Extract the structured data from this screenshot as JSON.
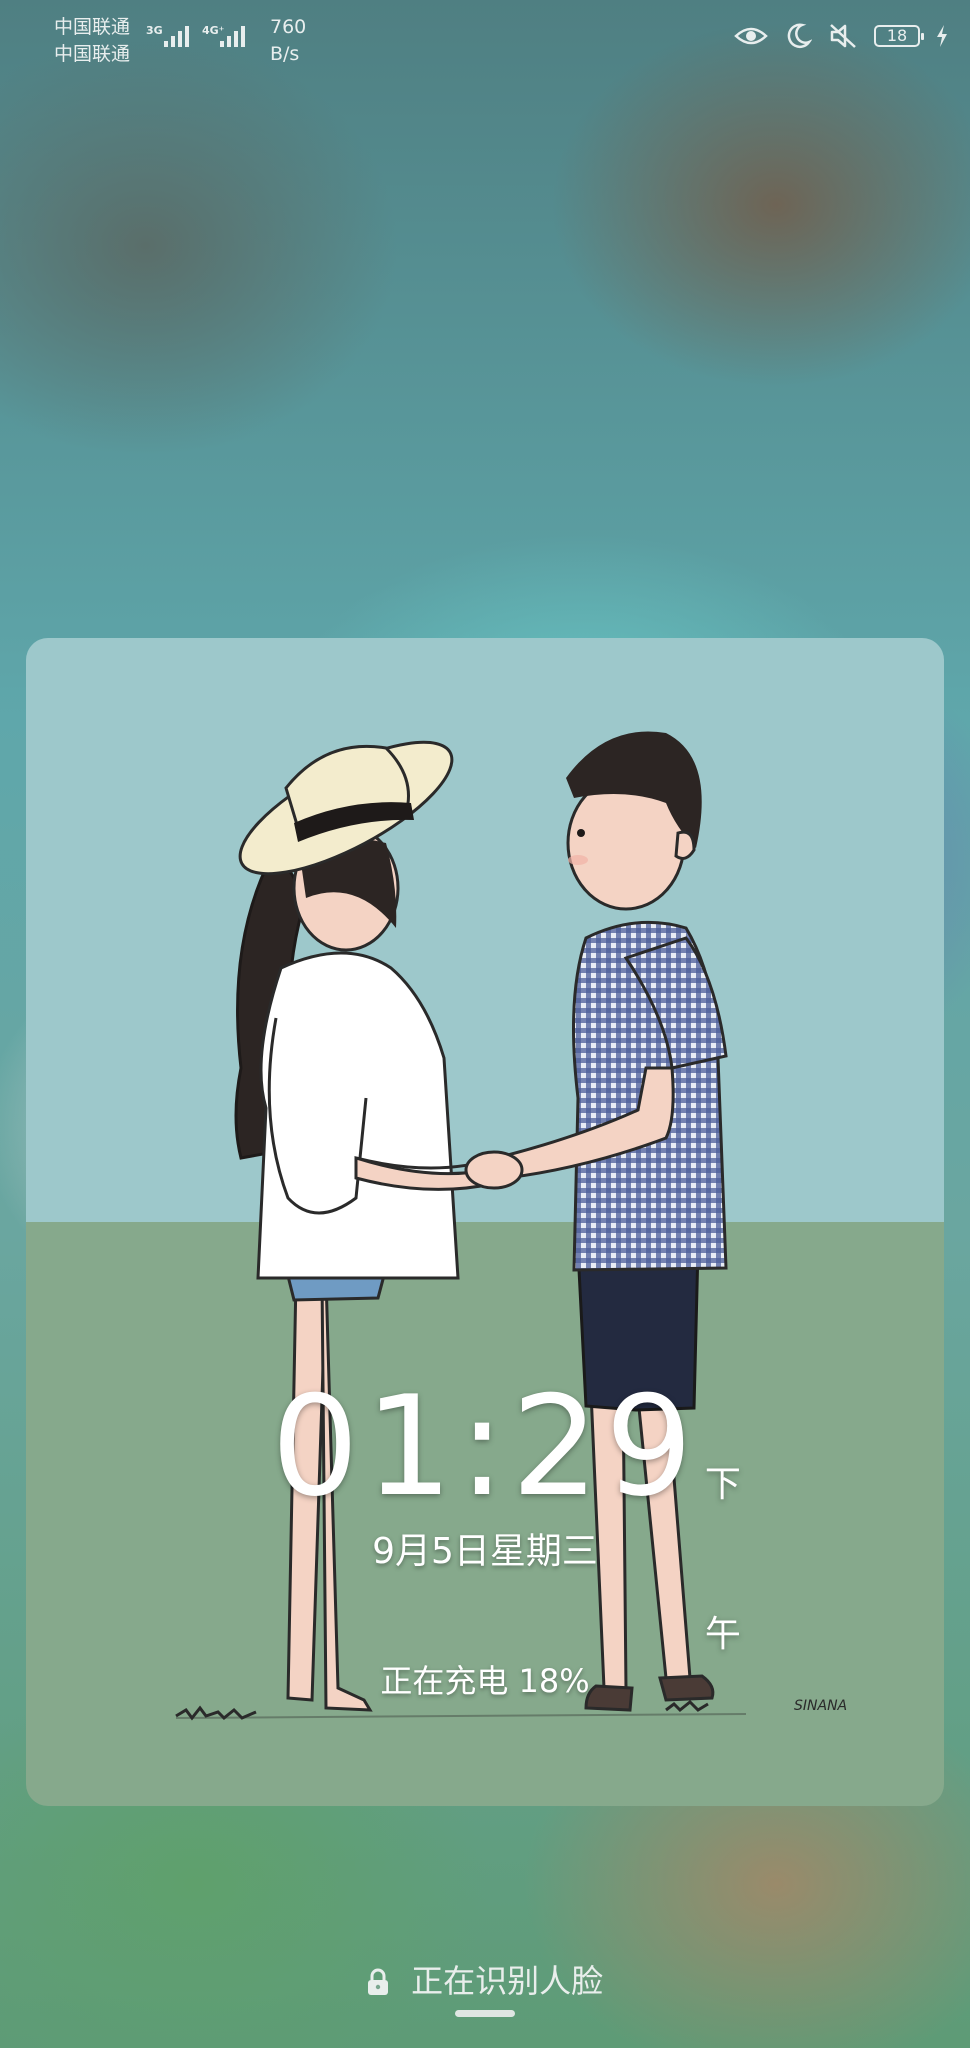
{
  "status_bar": {
    "carrier_1": "中国联通",
    "carrier_2": "中国联通",
    "network_1": "3G",
    "network_2": "4G⁺",
    "speed_value": "760",
    "speed_unit": "B/s",
    "battery_level": "18",
    "icons": [
      "eye-icon",
      "moon-icon",
      "mute-icon",
      "battery-icon",
      "charging-bolt-icon"
    ]
  },
  "lockscreen": {
    "time": "01:29",
    "ampm": "下午",
    "date": "9月5日星期三",
    "charging": "正在充电 18%",
    "face_unlock": "正在识别人脸"
  },
  "wallpaper": {
    "signature": "SINANA"
  },
  "colors": {
    "sky": "#9dc8cb",
    "grass": "#86a98c",
    "text": "#ffffff"
  }
}
